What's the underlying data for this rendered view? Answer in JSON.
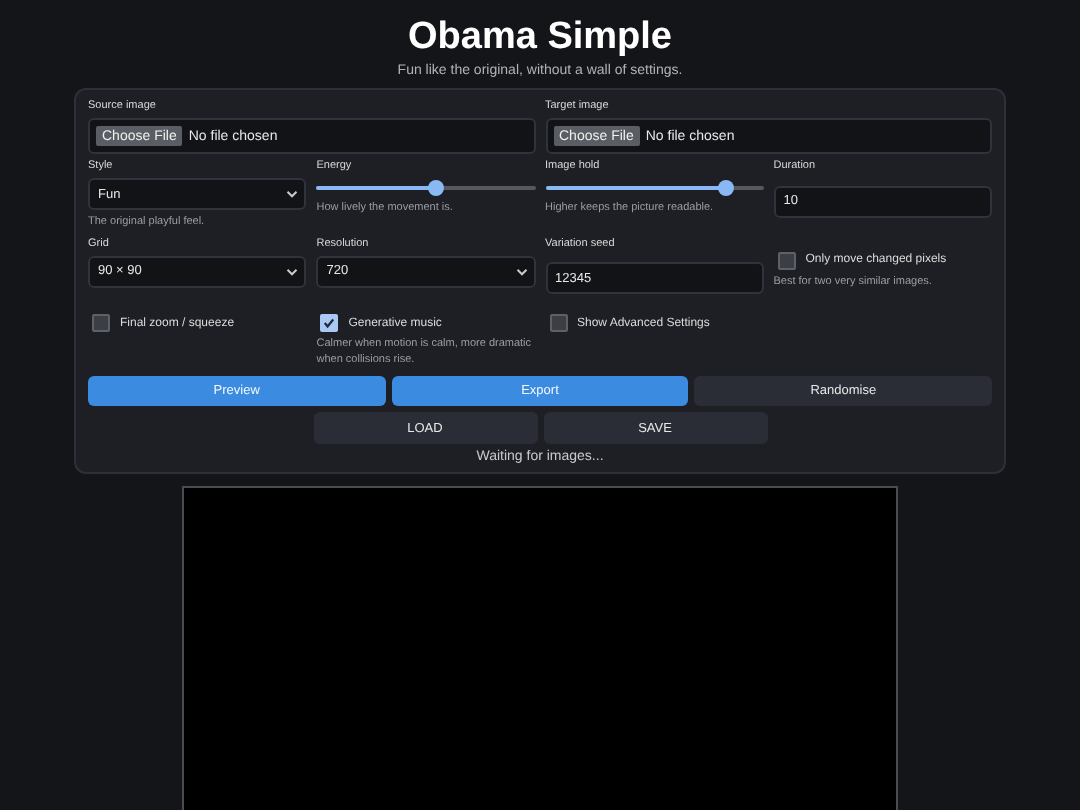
{
  "header": {
    "title": "Obama Simple",
    "subtitle": "Fun like the original, without a wall of settings."
  },
  "files": [
    {
      "label": "Source image",
      "button": "Choose File",
      "status": "No file chosen"
    },
    {
      "label": "Target image",
      "button": "Choose File",
      "status": "No file chosen"
    }
  ],
  "controls": [
    {
      "kind": "select",
      "label": "Style",
      "value": "Fun",
      "hint": "The original playful feel."
    },
    {
      "kind": "slider",
      "label": "Energy",
      "level": 0.55,
      "hint": "How lively the movement is."
    },
    {
      "kind": "slider",
      "label": "Image hold",
      "level": 0.83,
      "hint": "Higher keeps the picture readable."
    },
    {
      "kind": "input",
      "label": "Duration",
      "value": "10"
    },
    {
      "kind": "select",
      "label": "Grid",
      "value": "90 × 90"
    },
    {
      "kind": "select",
      "label": "Resolution",
      "value": "720"
    },
    {
      "kind": "input",
      "label": "Variation seed",
      "value": "12345"
    },
    {
      "kind": "checkbox",
      "label": "Only move changed pixels",
      "checked": false,
      "hint": "Best for two very similar images."
    },
    {
      "kind": "checkbox",
      "label": "Final zoom / squeeze",
      "checked": false
    },
    {
      "kind": "checkbox",
      "label": "Generative music",
      "checked": true,
      "hint": "Calmer when motion is calm, more dramatic when collisions rise."
    },
    {
      "kind": "checkbox",
      "label": "Show Advanced Settings",
      "checked": false
    }
  ],
  "actions": [
    {
      "label": "Preview",
      "primary": true
    },
    {
      "label": "Export",
      "primary": true
    },
    {
      "label": "Randomise",
      "primary": false
    }
  ],
  "storage": [
    "LOAD",
    "SAVE"
  ],
  "status": "Waiting for images..."
}
